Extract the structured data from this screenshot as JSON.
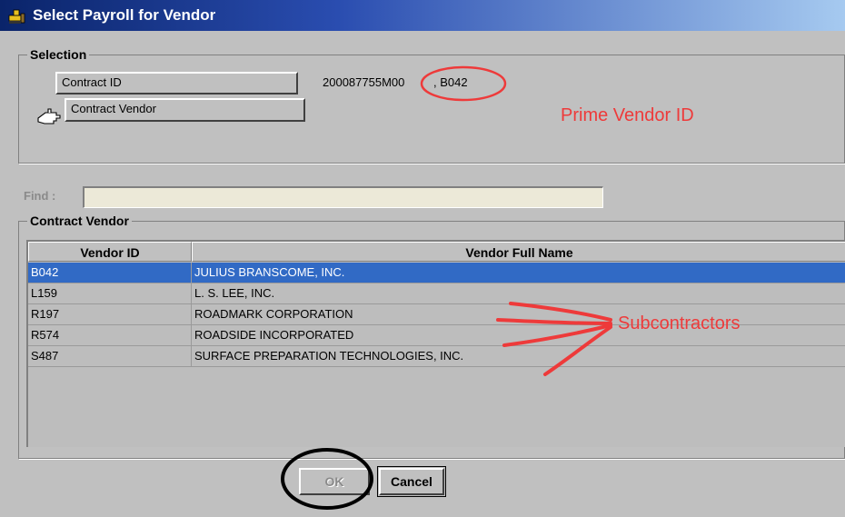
{
  "window": {
    "title": "Select Payroll for Vendor",
    "icon": "app-bulldozer-icon"
  },
  "selection": {
    "legend": "Selection",
    "contract_id_label": "Contract ID",
    "contract_id_value": "200087755M00",
    "contract_vendor_label": "Contract Vendor",
    "contract_vendor_value": ", B042",
    "pointer_icon": "hand-pointer-icon"
  },
  "find": {
    "label": "Find :",
    "value": ""
  },
  "contract_vendor": {
    "legend": "Contract Vendor",
    "columns": [
      "Vendor ID",
      "Vendor Full Name"
    ],
    "rows": [
      {
        "id": "B042",
        "name": "JULIUS BRANSCOME, INC.",
        "selected": true
      },
      {
        "id": "L159",
        "name": "L. S. LEE, INC.",
        "selected": false
      },
      {
        "id": "R197",
        "name": "ROADMARK CORPORATION",
        "selected": false
      },
      {
        "id": "R574",
        "name": "ROADSIDE INCORPORATED",
        "selected": false
      },
      {
        "id": "S487",
        "name": "SURFACE PREPARATION TECHNOLOGIES, INC.",
        "selected": false
      }
    ]
  },
  "buttons": {
    "ok": "OK",
    "cancel": "Cancel"
  },
  "annotations": {
    "prime_vendor": "Prime Vendor ID",
    "subcontractors": "Subcontractors",
    "color": "#ee3a3a"
  },
  "colors": {
    "selected_row": "#316ac5",
    "face": "#c0c0c0",
    "title_start": "#0a246a"
  }
}
